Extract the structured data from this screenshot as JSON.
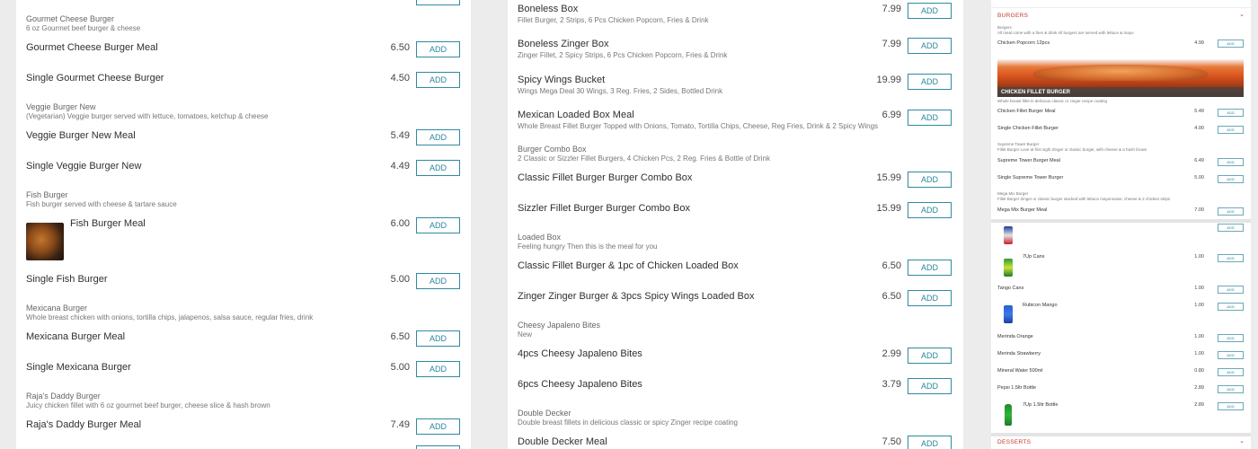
{
  "add_label": "ADD",
  "panel1": {
    "gourmet": {
      "name": "Gourmet Cheese Burger",
      "desc": "6 oz Gourmet beef burger & cheese",
      "meal": {
        "name": "Gourmet Cheese Burger Meal",
        "price": "6.50"
      },
      "single": {
        "name": "Single Gourmet Cheese Burger",
        "price": "4.50"
      }
    },
    "veggie": {
      "name": "Veggie Burger New",
      "desc": "(Vegetarian) Veggie burger served with lettuce, tomatoes, ketchup & cheese",
      "meal": {
        "name": "Veggie Burger New Meal",
        "price": "5.49"
      },
      "single": {
        "name": "Single Veggie Burger New",
        "price": "4.49"
      }
    },
    "fish": {
      "name": "Fish Burger",
      "desc": "Fish burger served with cheese & tartare sauce",
      "meal": {
        "name": "Fish Burger Meal",
        "price": "6.00"
      },
      "single": {
        "name": "Single Fish Burger",
        "price": "5.00"
      }
    },
    "mexicana": {
      "name": "Mexicana Burger",
      "desc": "Whole breast chicken with onions, tortilla chips, jalapenos, salsa sauce, regular fries, drink",
      "meal": {
        "name": "Mexicana Burger Meal",
        "price": "6.50"
      },
      "single": {
        "name": "Single Mexicana Burger",
        "price": "5.00"
      }
    },
    "rajas": {
      "name": "Raja's Daddy Burger",
      "desc": "Juicy chicken fillet with 6 oz gourmet beef burger, cheese slice & hash brown",
      "meal": {
        "name": "Raja's Daddy Burger Meal",
        "price": "7.49"
      }
    }
  },
  "panel2": {
    "boneless_box": {
      "name": "Boneless Box",
      "desc": "Fillet Burger, 2 Strips, 6 Pcs Chicken Popcorn, Fries & Drink",
      "price": "7.99"
    },
    "boneless_zinger": {
      "name": "Boneless Zinger Box",
      "desc": "Zinger Fillet, 2 Spicy Strips, 6 Pcs Chicken Popcorn, Fries & Drink",
      "price": "7.99"
    },
    "spicy_wings": {
      "name": "Spicy Wings Bucket",
      "desc": "Wings Mega Deal 30 Wings, 3 Reg. Fries, 2 Sides, Bottled Drink",
      "price": "19.99"
    },
    "mexican_loaded": {
      "name": "Mexican Loaded Box Meal",
      "desc": "Whole Breast Fillet Burger Topped with Onions, Tomato, Tortilla Chips, Cheese, Reg Fries, Drink & 2 Spicy Wings",
      "price": "6.99"
    },
    "combo": {
      "name": "Burger Combo Box",
      "desc": "2 Classic or Sizzler Fillet Burgers, 4 Chicken Pcs, 2 Reg. Fries & Bottle of Drink",
      "items": [
        {
          "name": "Classic Fillet Burger Burger Combo Box",
          "price": "15.99"
        },
        {
          "name": "Sizzler Fillet Burger Burger Combo Box",
          "price": "15.99"
        }
      ]
    },
    "loaded": {
      "name": "Loaded Box",
      "desc": "Feeling hungry Then this is the meal for you",
      "items": [
        {
          "name": "Classic Fillet Burger & 1pc of Chicken Loaded Box",
          "price": "6.50"
        },
        {
          "name": "Zinger Zinger Burger & 3pcs Spicy Wings Loaded Box",
          "price": "6.50"
        }
      ]
    },
    "jalapeno": {
      "name": "Cheesy Japaleno Bites",
      "desc": "New",
      "items": [
        {
          "name": "4pcs Cheesy Japaleno Bites",
          "price": "2.99"
        },
        {
          "name": "6pcs Cheesy Japaleno Bites",
          "price": "3.79"
        }
      ]
    },
    "double": {
      "name": "Double Decker",
      "desc": "Double breast fillets in delicious classic or spicy Zinger recipe coating",
      "items": [
        {
          "name": "Double Decker Meal",
          "price": "7.50"
        }
      ]
    }
  },
  "panel3": {
    "section_title": "BURGERS",
    "section_chevron": "⌄",
    "group_label": "Burgers",
    "group_desc": "All meal come with a fries & drink All burgers are served with lettuce & mayo",
    "popcorn": {
      "name": "Chicken Popcorn 12pcs",
      "price": "4.99"
    },
    "banner_label": "CHICKEN FILLET BURGER",
    "banner_desc": "Whole breast fillet in delicious classic or zinger recipe coating",
    "fillet_items": [
      {
        "name": "Chicken Fillet Burger Meal",
        "price": "5.49"
      },
      {
        "name": "Single Chicken Fillet Burger",
        "price": "4.00"
      }
    ],
    "supreme": {
      "name": "Supreme Tower Burger",
      "desc": "Fillet Burger Love at first sight Zinger or classic burger, with cheese & a hash brown",
      "items": [
        {
          "name": "Supreme Tower Burger Meal",
          "price": "6.49"
        },
        {
          "name": "Single Supreme Tower Burger",
          "price": "5.00"
        }
      ]
    },
    "mega": {
      "name": "Mega Mix Burger",
      "desc": "Fillet Burger Zinger or classic burger stacked with lettuce mayonnaise, cheese & 2 chicken strips",
      "items": [
        {
          "name": "Mega Mix Burger Meal",
          "price": "7.00"
        }
      ]
    },
    "drinks": [
      {
        "name": "7Up Cans",
        "price": "1.00"
      },
      {
        "name": "Tango Cans",
        "price": "1.00"
      },
      {
        "name": "Rubicon Mango",
        "price": "1.00"
      },
      {
        "name": "Merinda Orange",
        "price": "1.00"
      },
      {
        "name": "Merinda Strawberry",
        "price": "1.00"
      },
      {
        "name": "Mineral Water 500ml",
        "price": "0.80"
      },
      {
        "name": "Pepsi 1.5ltr Bottle",
        "price": "2.89"
      },
      {
        "name": "7Up 1.5ltr Bottle",
        "price": "2.89"
      }
    ],
    "desserts_title": "DESSERTS",
    "desserts_chevron": "⌄"
  },
  "colors": {
    "accent": "#2a86a0",
    "section": "#c0392b"
  }
}
